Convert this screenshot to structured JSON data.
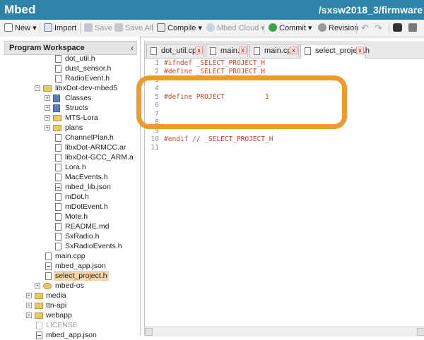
{
  "titlebar": {
    "app": "Mbed",
    "path": "/sxsw2018_3/firmware"
  },
  "toolbar": {
    "new": "New",
    "new_caret": "▾",
    "import": "Import",
    "save": "Save",
    "save_all": "Save All",
    "compile": "Compile",
    "compile_caret": "▾",
    "mbed_cloud": "Mbed Cloud",
    "mbed_cloud_caret": "▾",
    "commit": "Commit",
    "commit_caret": "▾",
    "revision": "Revision"
  },
  "sidebar": {
    "title": "Program Workspace",
    "collapse": "‹",
    "items": [
      {
        "label": "dot_util.h"
      },
      {
        "label": "dust_sensor.h"
      },
      {
        "label": "RadioEvent.h"
      },
      {
        "label": "libxDot-dev-mbed5",
        "expander": "−"
      },
      {
        "label": "Classes",
        "expander": "+"
      },
      {
        "label": "Structs",
        "expander": "+"
      },
      {
        "label": "MTS-Lora",
        "expander": "+"
      },
      {
        "label": "plans",
        "expander": "+"
      },
      {
        "label": "ChannelPlan.h"
      },
      {
        "label": "libxDot-ARMCC.ar"
      },
      {
        "label": "libxDot-GCC_ARM.a"
      },
      {
        "label": "Lora.h"
      },
      {
        "label": "MacEvents.h"
      },
      {
        "label": "mbed_lib.json"
      },
      {
        "label": "mDot.h"
      },
      {
        "label": "mDotEvent.h"
      },
      {
        "label": "Mote.h"
      },
      {
        "label": "README.md"
      },
      {
        "label": "SxRadio.h"
      },
      {
        "label": "SxRadioEvents.h"
      },
      {
        "label": "main.cpp"
      },
      {
        "label": "mbed_app.json"
      },
      {
        "label": "select_project.h"
      },
      {
        "label": "mbed-os",
        "expander": "+"
      },
      {
        "label": "media",
        "expander": "+"
      },
      {
        "label": "ttn-api",
        "expander": "+"
      },
      {
        "label": "webapp",
        "expander": "+"
      },
      {
        "label": "LICENSE"
      },
      {
        "label": "mbed_app.json"
      }
    ]
  },
  "tabs": [
    {
      "label": "dot_util.cpp",
      "close": "x"
    },
    {
      "label": "main.h",
      "close": "x"
    },
    {
      "label": "main.cpp",
      "close": "x"
    },
    {
      "label": "select_project.h",
      "close": "x"
    }
  ],
  "code": {
    "line_numbers": [
      "1",
      "2",
      "3",
      "4",
      "5",
      "6",
      "7",
      "8",
      "9",
      "10",
      "11"
    ],
    "lines": [
      "#ifndef _SELECT_PROJECT_H",
      "#define _SELECT_PROJECT_H",
      "",
      "",
      "#define PROJECT          1",
      "",
      "",
      "",
      "",
      "#endif // _SELECT_PROJECT_H",
      ""
    ]
  },
  "highlight_color": "#ef9a2d",
  "accent": "#2e83a8"
}
